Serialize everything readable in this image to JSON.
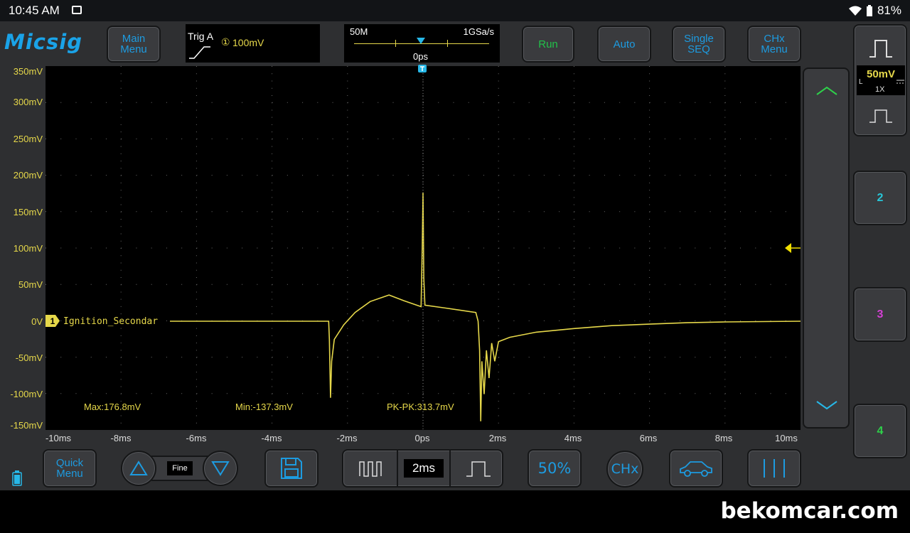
{
  "status_bar": {
    "time": "10:45 AM",
    "battery": "81%"
  },
  "header": {
    "logo": "Micsig",
    "main_menu": [
      "Main",
      "Menu"
    ],
    "trigger": {
      "label": "Trig A",
      "channel": "①",
      "level": "100mV"
    },
    "timebase": {
      "memory": "50M",
      "sample_rate": "1GSa/s",
      "position": "0ps"
    },
    "run": "Run",
    "auto": "Auto",
    "single_seq": [
      "Single",
      "SEQ"
    ],
    "chx_menu": [
      "CHx",
      "Menu"
    ]
  },
  "channel": {
    "number": "1",
    "label": "Ignition_Secondar",
    "color": "#e6d84a",
    "scale": "50mV",
    "coupling": "L",
    "probe": "1X"
  },
  "y_axis": [
    "350mV",
    "300mV",
    "250mV",
    "200mV",
    "150mV",
    "100mV",
    "50mV",
    "0V",
    "-50mV",
    "-100mV",
    "-150mV"
  ],
  "x_axis": [
    "-10ms",
    "-8ms",
    "-6ms",
    "-4ms",
    "-2ms",
    "0ps",
    "2ms",
    "4ms",
    "6ms",
    "8ms",
    "10ms"
  ],
  "measurements": {
    "max": "Max:176.8mV",
    "min": "Min:-137.3mV",
    "pkpk": "PK-PK:313.7mV"
  },
  "right_panel": {
    "ch2": "2",
    "ch3": "3",
    "ch4": "4",
    "ch2_color": "#27c6d8",
    "ch3_color": "#d43fd4",
    "ch4_color": "#2ed14a"
  },
  "bottom": {
    "quick_menu": [
      "Quick",
      "Menu"
    ],
    "fine": "Fine",
    "timebase_value": "2ms",
    "fifty_percent": "50%",
    "chx": "CHx"
  },
  "watermark": "bekomcar.com",
  "waveform": {
    "unit": "ms / mV",
    "points": [
      [
        -10,
        0
      ],
      [
        -2.5,
        0
      ],
      [
        -2.48,
        -25
      ],
      [
        -2.45,
        -105
      ],
      [
        -2.42,
        -55
      ],
      [
        -2.35,
        -25
      ],
      [
        -2.1,
        -5
      ],
      [
        -1.8,
        12
      ],
      [
        -1.4,
        27
      ],
      [
        -0.9,
        36
      ],
      [
        -0.5,
        28
      ],
      [
        -0.05,
        20
      ],
      [
        -0.02,
        100
      ],
      [
        0,
        176.8
      ],
      [
        0.02,
        60
      ],
      [
        0.05,
        22
      ],
      [
        0.6,
        18
      ],
      [
        1.4,
        12
      ],
      [
        1.46,
        0
      ],
      [
        1.5,
        -40
      ],
      [
        1.53,
        -137.3
      ],
      [
        1.56,
        -55
      ],
      [
        1.62,
        -100
      ],
      [
        1.68,
        -40
      ],
      [
        1.75,
        -78
      ],
      [
        1.82,
        -30
      ],
      [
        1.9,
        -55
      ],
      [
        2.0,
        -28
      ],
      [
        2.3,
        -22
      ],
      [
        3,
        -15
      ],
      [
        4,
        -10
      ],
      [
        5,
        -6
      ],
      [
        6,
        -4
      ],
      [
        7,
        -2
      ],
      [
        8,
        -1
      ],
      [
        10,
        0
      ]
    ]
  }
}
